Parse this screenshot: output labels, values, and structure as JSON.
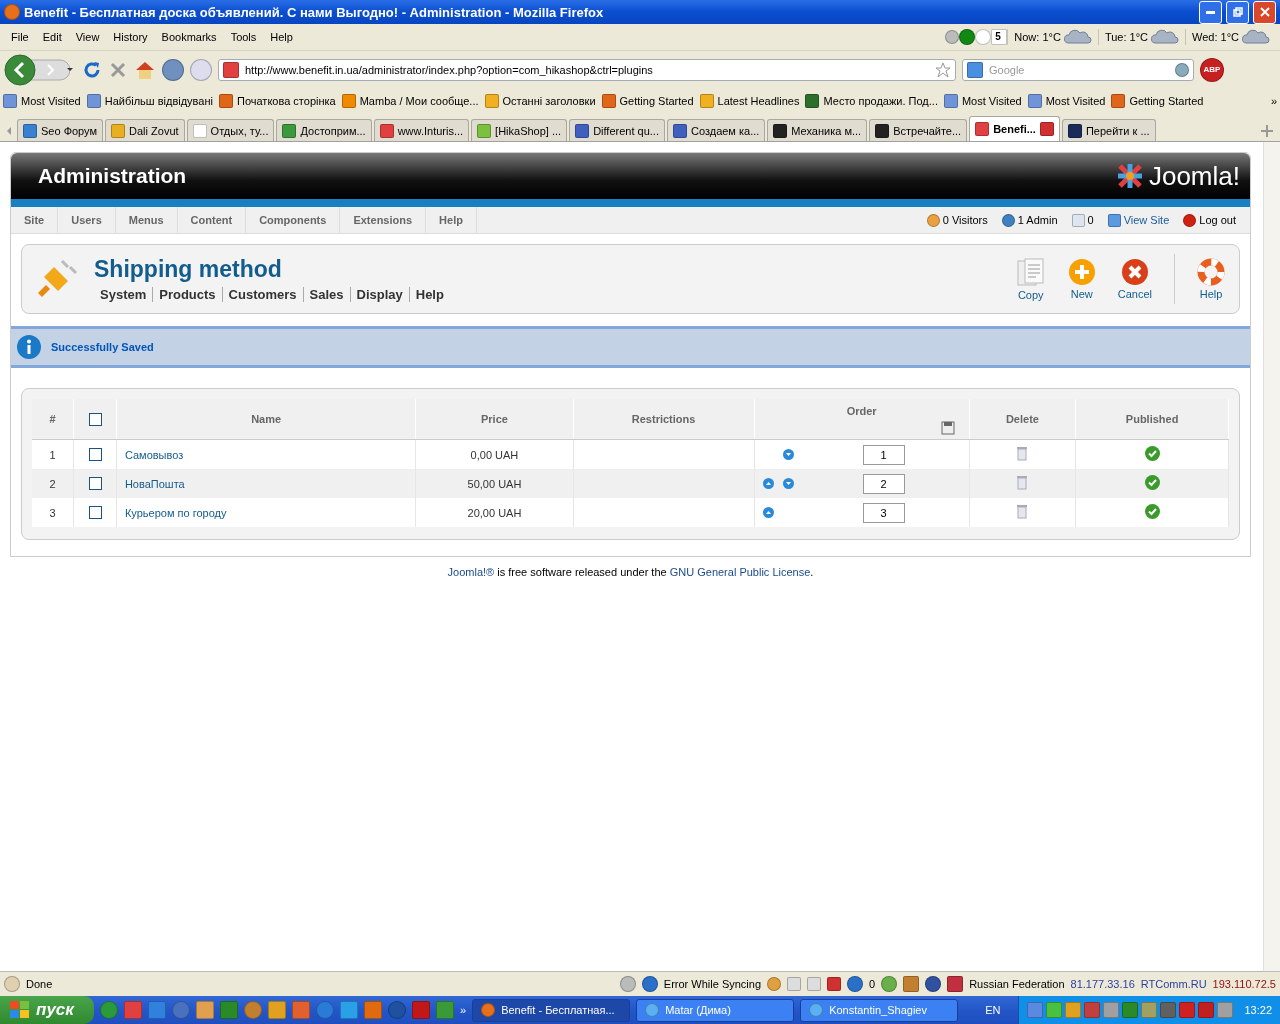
{
  "window": {
    "title": "Benefit - Бесплатная доска объявлений. С нами Выгодно! - Administration - Mozilla Firefox"
  },
  "menu": [
    "File",
    "Edit",
    "View",
    "History",
    "Bookmarks",
    "Tools",
    "Help"
  ],
  "weather": [
    {
      "label": "Now: 1°C"
    },
    {
      "label": "Tue: 1°C"
    },
    {
      "label": "Wed: 1°C"
    }
  ],
  "calendar_day": "5",
  "address": {
    "value": "http://www.benefit.in.ua/administrator/index.php?option=com_hikashop&ctrl=plugins"
  },
  "search": {
    "placeholder": "Google"
  },
  "abp": "ABP",
  "bookmarks": [
    {
      "label": "Most Visited",
      "color": "#6f95d8"
    },
    {
      "label": "Найбільш відвідувані",
      "color": "#6f95d8"
    },
    {
      "label": "Початкова сторінка",
      "color": "#e0661a"
    },
    {
      "label": "Mamba / Мои сообще...",
      "color": "#f08a00"
    },
    {
      "label": "Останні заголовки",
      "color": "#f0b020"
    },
    {
      "label": "Getting Started",
      "color": "#e0661a"
    },
    {
      "label": "Latest Headlines",
      "color": "#f0b020"
    },
    {
      "label": "Место продажи. Под...",
      "color": "#2c6e2c"
    },
    {
      "label": "Most Visited",
      "color": "#6f95d8"
    },
    {
      "label": "Most Visited",
      "color": "#6f95d8"
    },
    {
      "label": "Getting Started",
      "color": "#e0661a"
    }
  ],
  "bookmarks_more": "»",
  "tabs": [
    {
      "label": "Seo Форум",
      "color": "#3a7fd0",
      "selected": false
    },
    {
      "label": "Dali Zovut",
      "color": "#e8b020",
      "selected": false
    },
    {
      "label": "Отдых, ту...",
      "color": "#ffffff",
      "selected": false
    },
    {
      "label": "Достоприм...",
      "color": "#3c9a3c",
      "selected": false
    },
    {
      "label": "www.Inturis...",
      "color": "#e04040",
      "selected": false
    },
    {
      "label": "[HikaShop] ...",
      "color": "#7cc040",
      "selected": false
    },
    {
      "label": "Different qu...",
      "color": "#4060c0",
      "selected": false
    },
    {
      "label": "Создаем ка...",
      "color": "#4060c0",
      "selected": false
    },
    {
      "label": "Механика м...",
      "color": "#222222",
      "selected": false
    },
    {
      "label": "Встречайте...",
      "color": "#222222",
      "selected": false
    },
    {
      "label": "Benefi...",
      "color": "#e04040",
      "selected": true
    },
    {
      "label": "Перейти к ...",
      "color": "#1a2a5a",
      "selected": false
    }
  ],
  "admin": {
    "title": "Administration",
    "logo": "Joomla!",
    "nav": [
      "Site",
      "Users",
      "Menus",
      "Content",
      "Components",
      "Extensions",
      "Help"
    ],
    "status": [
      {
        "kind": "visitors",
        "label": "0 Visitors"
      },
      {
        "kind": "admins",
        "label": "1 Admin"
      },
      {
        "kind": "messages",
        "label": "0"
      },
      {
        "kind": "link",
        "label": "View Site"
      },
      {
        "kind": "logout",
        "label": "Log out"
      }
    ],
    "page_title": "Shipping method",
    "submenu": [
      "System",
      "Products",
      "Customers",
      "Sales",
      "Display",
      "Help"
    ],
    "toolbar": [
      {
        "kind": "copy",
        "label": "Copy"
      },
      {
        "kind": "new",
        "label": "New"
      },
      {
        "kind": "cancel",
        "label": "Cancel"
      },
      {
        "kind": "help",
        "label": "Help"
      }
    ],
    "message": "Successfully Saved",
    "table": {
      "select_all": {
        "checked": false
      },
      "columns": [
        "#",
        "",
        "Name",
        "Price",
        "Restrictions",
        "Order",
        "Delete",
        "Published"
      ],
      "rows": [
        {
          "num": "1",
          "checked": false,
          "name": "Самовывоз",
          "price": "0,00 UAH",
          "up": false,
          "down": true,
          "order": "1",
          "published": true
        },
        {
          "num": "2",
          "checked": false,
          "name": "НоваПошта",
          "price": "50,00 UAH",
          "up": true,
          "down": true,
          "order": "2",
          "published": true
        },
        {
          "num": "3",
          "checked": false,
          "name": "Курьером по городу",
          "price": "20,00 UAH",
          "up": true,
          "down": false,
          "order": "3",
          "published": true
        }
      ]
    },
    "footer": {
      "link1": "Joomla!®",
      "text": " is free software released under the ",
      "link2": "GNU General Public License",
      "end": "."
    }
  },
  "status_bar": {
    "text": "Done",
    "sync": "Error While Syncing",
    "count": "0",
    "country": "Russian Federation",
    "ip": "81.177.33.16",
    "provider": "RTComm.RU",
    "ip2": "193.110.72.5"
  },
  "taskbar": {
    "start": "пуск",
    "more": "»",
    "tasks": [
      {
        "label": "Benefit - Бесплатная...",
        "selected": true
      },
      {
        "label": "Matar (Дима)",
        "selected": false
      },
      {
        "label": "Konstantin_Shagiev",
        "selected": false
      }
    ],
    "lang": "EN",
    "clock": "13:22"
  }
}
